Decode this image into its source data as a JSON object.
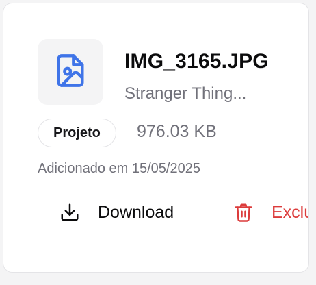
{
  "file": {
    "name": "IMG_3165.JPG",
    "project": "Stranger Thing...",
    "category": "Projeto",
    "size": "976.03 KB",
    "added": "Adicionado em 15/05/2025",
    "icon": "image-file-icon"
  },
  "actions": {
    "download_label": "Download",
    "download_icon": "download-icon",
    "delete_label": "Excluir",
    "delete_icon": "trash-icon"
  },
  "colors": {
    "accent": "#3f74e8",
    "danger": "#dc3c3c"
  }
}
